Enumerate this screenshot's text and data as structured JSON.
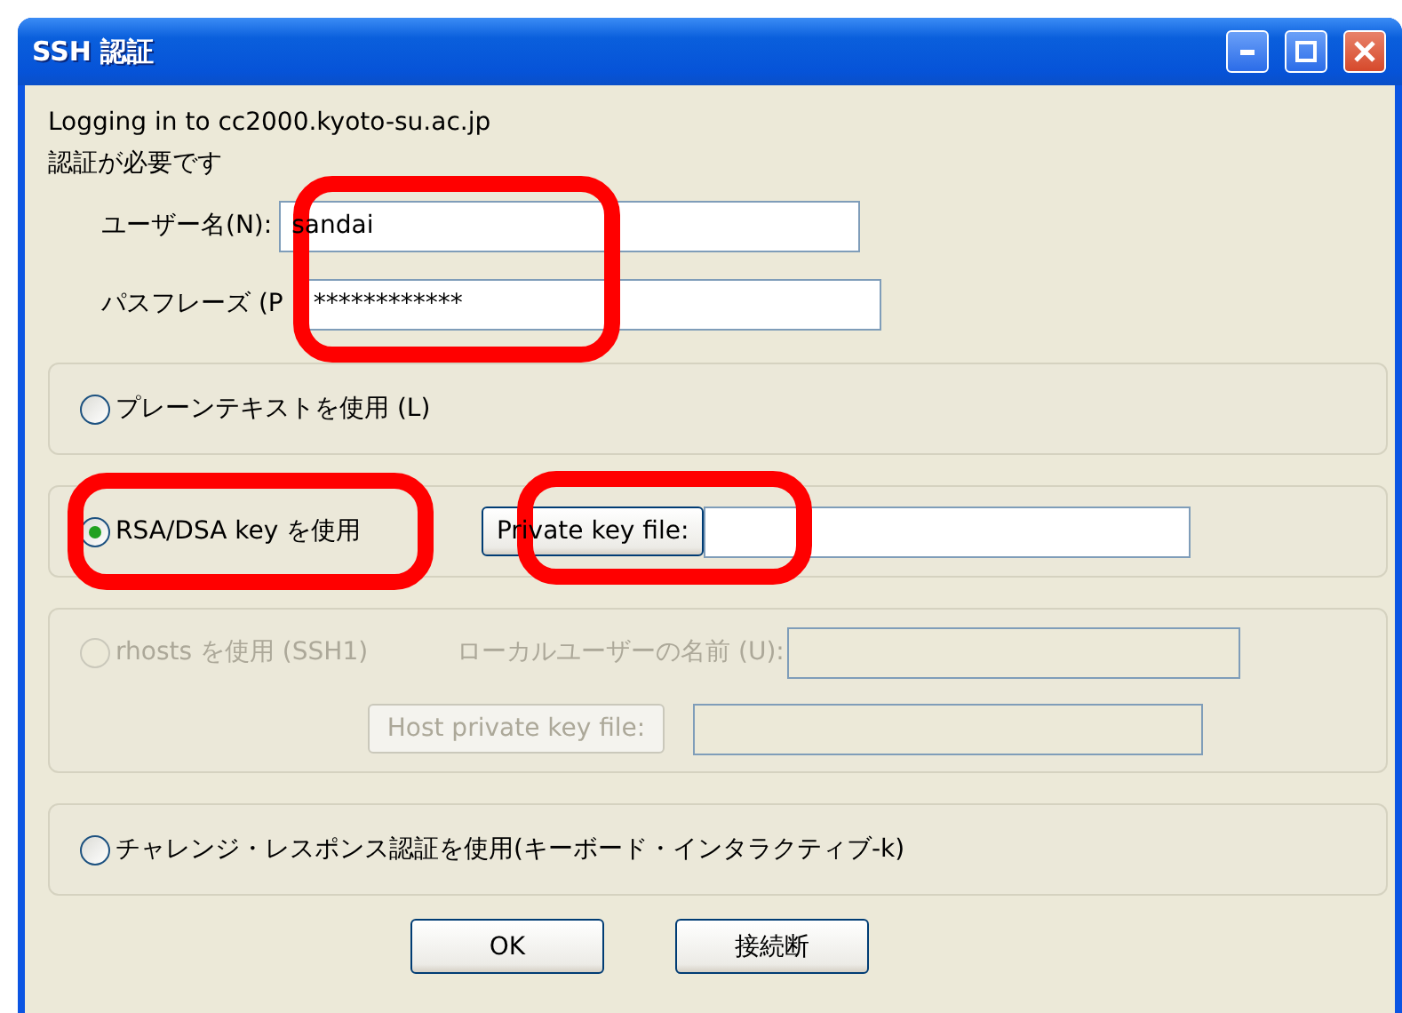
{
  "window": {
    "title": "SSH 認証"
  },
  "message": [
    "Logging in to cc2000.kyoto-su.ac.jp",
    "認証が必要です"
  ],
  "credentials": {
    "highlighted": true,
    "fields": [
      {
        "label": "ユーザー名(N):",
        "value": "sandai"
      },
      {
        "label": "パスフレーズ (P",
        "value": "************"
      }
    ]
  },
  "methods": [
    {
      "kind": "plain",
      "label": "プレーンテキストを使用 (L)",
      "selected": false,
      "disabled": false
    },
    {
      "kind": "key",
      "label": "RSA/DSA key を使用",
      "selected": true,
      "disabled": false,
      "highlighted": true,
      "button": "Private key file:",
      "button_highlighted": true
    },
    {
      "kind": "rhosts",
      "label": "rhosts を使用 (SSH1)",
      "selected": false,
      "disabled": true,
      "field_label": "ローカルユーザーの名前 (U):",
      "button": "Host private key file:"
    },
    {
      "kind": "challenge",
      "label": "チャレンジ・レスポンス認証を使用(キーボード・インタラクティブ-k)",
      "selected": false,
      "disabled": false
    }
  ],
  "buttons": [
    "OK",
    "接続断"
  ]
}
